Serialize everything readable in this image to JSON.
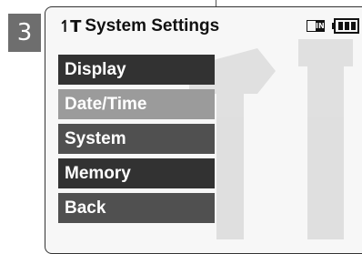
{
  "step_number": "3",
  "screen": {
    "title_icon": "tools-icon",
    "title": "System Settings",
    "status_icons": [
      "memory-card-icon",
      "battery-icon"
    ],
    "memory_card_label": "IN"
  },
  "menu": {
    "items": [
      {
        "label": "Display",
        "state": "normal"
      },
      {
        "label": "Date/Time",
        "state": "highlighted"
      },
      {
        "label": "System",
        "state": "normal"
      },
      {
        "label": "Memory",
        "state": "normal"
      },
      {
        "label": "Back",
        "state": "normal"
      }
    ]
  },
  "colors": {
    "menu_bg": "#323232",
    "menu_highlight_bg": "#9b9b9b",
    "menu_text": "#ffffff",
    "badge_bg": "#6e6e6e"
  }
}
